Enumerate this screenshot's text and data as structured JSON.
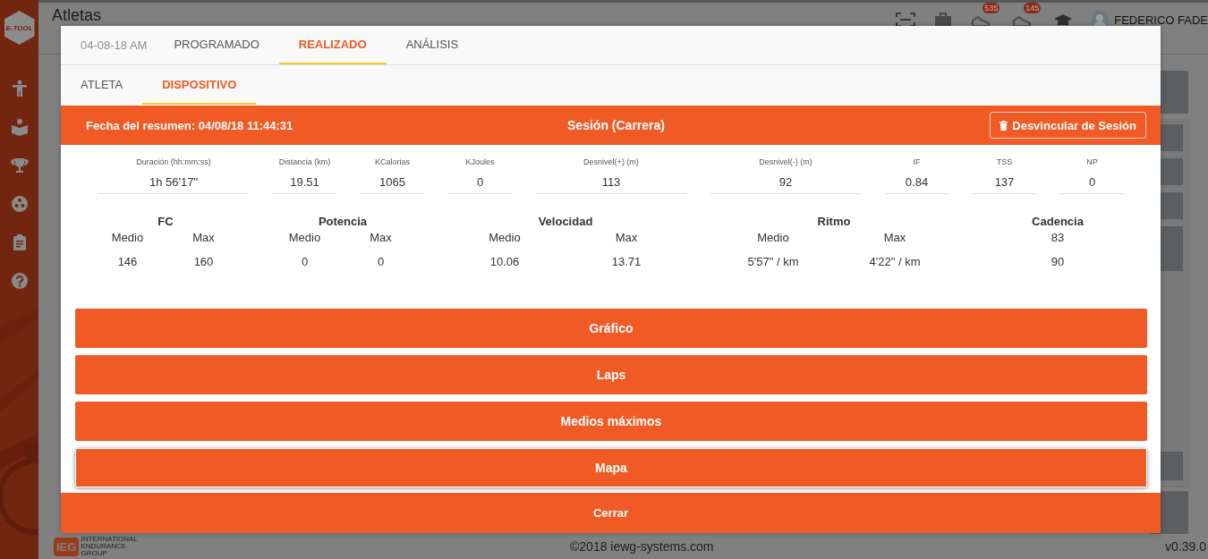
{
  "sidebar": {
    "logo": "E-TOOL"
  },
  "header": {
    "title": "Atletas",
    "badges": [
      "535",
      "145"
    ],
    "user": "FEDERICO FADE"
  },
  "modal": {
    "date": "04-08-18 AM",
    "tabs": [
      {
        "label": "PROGRAMADO",
        "selected": false
      },
      {
        "label": "REALIZADO",
        "selected": true
      },
      {
        "label": "ANÁLISIS",
        "selected": false
      }
    ],
    "subtabs": [
      {
        "label": "ATLETA",
        "selected": false
      },
      {
        "label": "DISPOSITIVO",
        "selected": true
      }
    ],
    "session": {
      "summary_date": "Fecha del resumen: 04/08/18 11:44:31",
      "title": "Sesión (Carrera)",
      "unlink_button": "Desvincular de Sesión"
    },
    "stats": [
      {
        "label": "Duración (hh:mm:ss)",
        "value": "1h 56'17\""
      },
      {
        "label": "Distancia (km)",
        "value": "19.51"
      },
      {
        "label": "KCalorias",
        "value": "1065"
      },
      {
        "label": "KJoules",
        "value": "0"
      },
      {
        "label": "Desnivel(+) (m)",
        "value": "113"
      },
      {
        "label": "Desnivel(-) (m)",
        "value": "92"
      },
      {
        "label": "IF",
        "value": "0.84"
      },
      {
        "label": "TSS",
        "value": "137"
      },
      {
        "label": "NP",
        "value": "0"
      }
    ],
    "groups": [
      {
        "title": "FC",
        "kind": "split",
        "columns": [
          {
            "label": "Medio",
            "value": "146"
          },
          {
            "label": "Max",
            "value": "160"
          }
        ]
      },
      {
        "title": "Potencia",
        "kind": "split",
        "columns": [
          {
            "label": "Medio",
            "value": "0"
          },
          {
            "label": "Max",
            "value": "0"
          }
        ]
      },
      {
        "title": "Velocidad",
        "kind": "split",
        "columns": [
          {
            "label": "Medio",
            "value": "10.06"
          },
          {
            "label": "Max",
            "value": "13.71"
          }
        ]
      },
      {
        "title": "Ritmo",
        "kind": "split",
        "columns": [
          {
            "label": "Medio",
            "value": "5'57\" / km"
          },
          {
            "label": "Max",
            "value": "4'22\" / km"
          }
        ]
      },
      {
        "title": "Cadencia",
        "kind": "stacked",
        "values": [
          "83",
          "90"
        ]
      }
    ],
    "sections": [
      {
        "label": "Gráfico",
        "highlighted": false
      },
      {
        "label": "Laps",
        "highlighted": false
      },
      {
        "label": "Medios máximos",
        "highlighted": false
      },
      {
        "label": "Mapa",
        "highlighted": true
      }
    ],
    "close_button": "Cerrar"
  },
  "footer": {
    "logo": "IEG",
    "logo_lines": [
      "INTERNATIONAL",
      "ENDURANCE",
      "GROUP"
    ],
    "copyright": "©2018 iewg-systems.com",
    "version": "v0.39.0"
  }
}
